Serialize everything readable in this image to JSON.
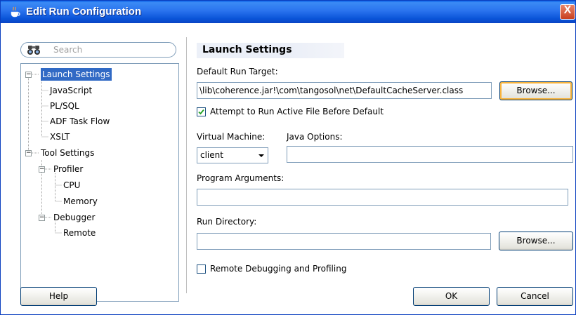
{
  "window": {
    "title": "Edit Run Configuration",
    "close_glyph": "X"
  },
  "search": {
    "placeholder": "Search"
  },
  "tree": {
    "items": [
      {
        "label": "Launch Settings",
        "selected": true
      },
      {
        "label": "JavaScript"
      },
      {
        "label": "PL/SQL"
      },
      {
        "label": "ADF Task Flow"
      },
      {
        "label": "XSLT"
      },
      {
        "label": "Tool Settings"
      },
      {
        "label": "Profiler"
      },
      {
        "label": "CPU"
      },
      {
        "label": "Memory"
      },
      {
        "label": "Debugger"
      },
      {
        "label": "Remote"
      }
    ],
    "expander_glyph": "−"
  },
  "panel": {
    "heading": "Launch Settings",
    "default_run_target_label": "Default Run Target:",
    "default_run_target_value": "\\lib\\coherence.jar!\\com\\tangosol\\net\\DefaultCacheServer.class",
    "browse_label": "Browse...",
    "attempt_label": "Attempt to Run Active File Before Default",
    "attempt_checked": true,
    "virtual_machine_label": "Virtual Machine:",
    "virtual_machine_value": "client",
    "java_options_label": "Java Options:",
    "java_options_value": "",
    "program_arguments_label": "Program Arguments:",
    "program_arguments_value": "",
    "run_directory_label": "Run Directory:",
    "run_directory_value": "",
    "run_directory_browse_label": "Browse...",
    "remote_debugging_label": "Remote Debugging and Profiling",
    "remote_debugging_checked": false
  },
  "footer": {
    "help_label": "Help",
    "ok_label": "OK",
    "cancel_label": "Cancel"
  },
  "colors": {
    "title_bar": "#2a73ee",
    "selection": "#316ac5",
    "focus_ring": "#f8b33b"
  }
}
